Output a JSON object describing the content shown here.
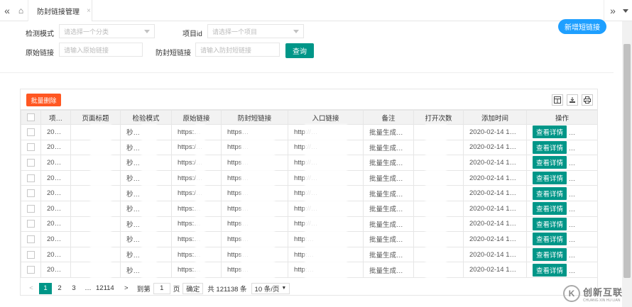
{
  "tabs": {
    "back_glyph": "«",
    "home_glyph": "⌂",
    "active_label": "防封链接管理",
    "close_glyph": "×",
    "forward_glyph": "»"
  },
  "form": {
    "detect_mode_label": "检测模式",
    "detect_mode_placeholder": "请选择一个分类",
    "project_label": "项目id",
    "project_placeholder": "请选择一个项目",
    "origin_label": "原始链接",
    "origin_placeholder": "请输入原始链接",
    "short_label": "防封短链接",
    "short_placeholder": "请输入防封短链接",
    "query_button": "查询",
    "new_button": "新增短链接"
  },
  "toolbar": {
    "batch_delete": "批量删除"
  },
  "table": {
    "headers": [
      "项…",
      "页面标题",
      "检验模式",
      "原始链接",
      "防封短链接",
      "入口链接",
      "备注",
      "打开次数",
      "添加时间",
      "操作"
    ],
    "rows": [
      {
        "id": "20…",
        "title": "",
        "mode": "秒…",
        "origin": "https:…",
        "short": "https…",
        "entry": "http://…",
        "note": "批量生成…",
        "opens": "",
        "time": "2020-02-14 1…",
        "action": "查看详情"
      },
      {
        "id": "20…",
        "title": "",
        "mode": "秒…",
        "origin": "https:/…",
        "short": "https…",
        "entry": "http://…",
        "note": "批量生成…",
        "opens": "",
        "time": "2020-02-14 1…",
        "action": "查看详情"
      },
      {
        "id": "20…",
        "title": "",
        "mode": "秒…",
        "origin": "https:/…",
        "short": "https…",
        "entry": "http://…",
        "note": "批量生成…",
        "opens": "",
        "time": "2020-02-14 1…",
        "action": "查看详情"
      },
      {
        "id": "20…",
        "title": "",
        "mode": "秒…",
        "origin": "https:/…",
        "short": "https…",
        "entry": "http://…",
        "note": "批量生成…",
        "opens": "",
        "time": "2020-02-14 1…",
        "action": "查看详情"
      },
      {
        "id": "20…",
        "title": "",
        "mode": "秒…",
        "origin": "https:/…",
        "short": "https…",
        "entry": "http://…",
        "note": "批量生成…",
        "opens": "",
        "time": "2020-02-14 1…",
        "action": "查看详情"
      },
      {
        "id": "20…",
        "title": "",
        "mode": "秒…",
        "origin": "https:…",
        "short": "https…",
        "entry": "http://…",
        "note": "批量生成…",
        "opens": "",
        "time": "2020-02-14 1…",
        "action": "查看详情"
      },
      {
        "id": "20…",
        "title": "",
        "mode": "秒…",
        "origin": "https:…",
        "short": "https…",
        "entry": "http://…",
        "note": "批量生成…",
        "opens": "",
        "time": "2020-02-14 1…",
        "action": "查看详情"
      },
      {
        "id": "20…",
        "title": "",
        "mode": "秒…",
        "origin": "https:…",
        "short": "https…",
        "entry": "http:…",
        "note": "批量生成…",
        "opens": "",
        "time": "2020-02-14 1…",
        "action": "查看详情"
      },
      {
        "id": "20…",
        "title": "",
        "mode": "秒…",
        "origin": "https:…",
        "short": "https…",
        "entry": "http:…",
        "note": "批量生成…",
        "opens": "",
        "time": "2020-02-14 1…",
        "action": "查看详情"
      },
      {
        "id": "20…",
        "title": "",
        "mode": "秒…",
        "origin": "https:…",
        "short": "https…",
        "entry": "http:…",
        "note": "批量生成…",
        "opens": "",
        "time": "2020-02-14 1…",
        "action": "查看详情"
      }
    ]
  },
  "pager": {
    "prev": "<",
    "pages": [
      "1",
      "2",
      "3"
    ],
    "ellipsis": "…",
    "last": "12114",
    "next": ">",
    "goto_label": "到第",
    "goto_value": "1",
    "page_unit": "页",
    "confirm": "确定",
    "total": "共 121138 条",
    "size": "10 条/页"
  },
  "watermark": {
    "brand": "创新互联",
    "sub": "CHUANG XIN HU LIAN"
  }
}
